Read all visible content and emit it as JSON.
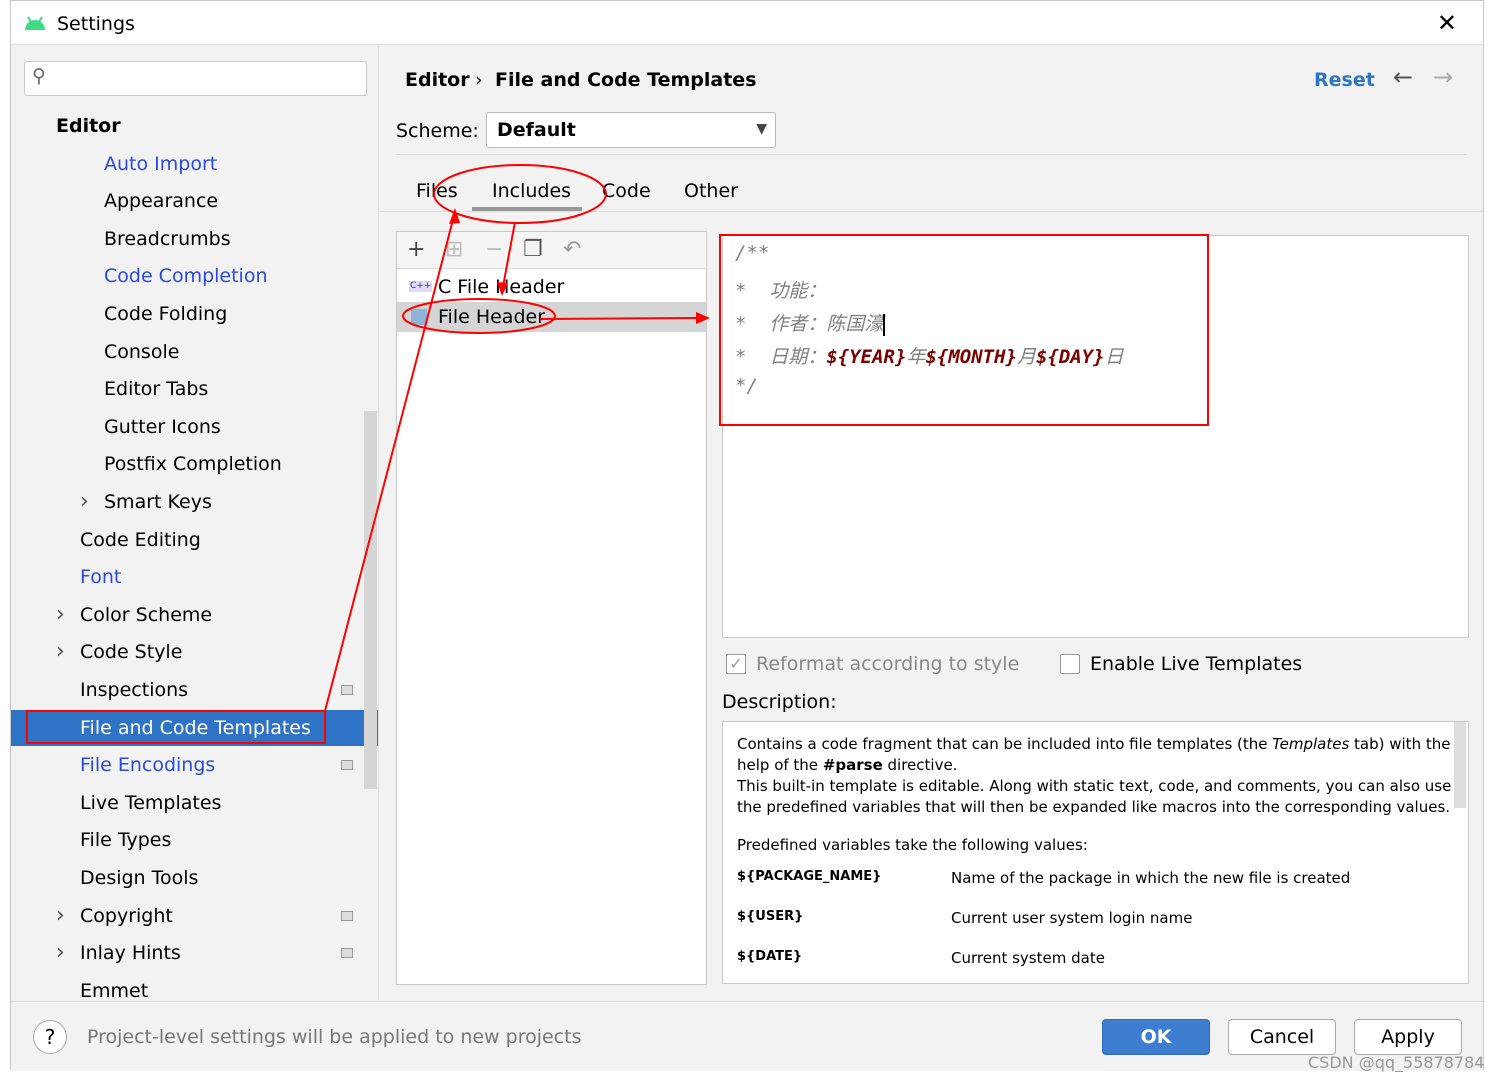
{
  "window": {
    "title": "Settings"
  },
  "sidebar": {
    "items": [
      {
        "label": "Editor",
        "level": 0,
        "bold": true
      },
      {
        "label": "Auto Import",
        "level": 2,
        "link": true
      },
      {
        "label": "Appearance",
        "level": 2
      },
      {
        "label": "Breadcrumbs",
        "level": 2
      },
      {
        "label": "Code Completion",
        "level": 2,
        "link": true
      },
      {
        "label": "Code Folding",
        "level": 2
      },
      {
        "label": "Console",
        "level": 2
      },
      {
        "label": "Editor Tabs",
        "level": 2
      },
      {
        "label": "Gutter Icons",
        "level": 2
      },
      {
        "label": "Postfix Completion",
        "level": 2
      },
      {
        "label": "Smart Keys",
        "level": 2,
        "chevron": true
      },
      {
        "label": "Code Editing",
        "level": 1
      },
      {
        "label": "Font",
        "level": 1,
        "link": true
      },
      {
        "label": "Color Scheme",
        "level": 1,
        "chevron": true
      },
      {
        "label": "Code Style",
        "level": 1,
        "chevron": true
      },
      {
        "label": "Inspections",
        "level": 1,
        "project": true
      },
      {
        "label": "File and Code Templates",
        "level": 1,
        "selected": true
      },
      {
        "label": "File Encodings",
        "level": 1,
        "link": true,
        "project": true
      },
      {
        "label": "Live Templates",
        "level": 1
      },
      {
        "label": "File Types",
        "level": 1
      },
      {
        "label": "Design Tools",
        "level": 1
      },
      {
        "label": "Copyright",
        "level": 1,
        "chevron": true,
        "project": true
      },
      {
        "label": "Inlay Hints",
        "level": 1,
        "chevron": true,
        "project": true
      },
      {
        "label": "Emmet",
        "level": 1
      }
    ]
  },
  "header": {
    "crumb1": "Editor",
    "sep": "›",
    "crumb2": "File and Code Templates",
    "reset": "Reset"
  },
  "scheme": {
    "label": "Scheme:",
    "value": "Default"
  },
  "tabs": [
    "Files",
    "Includes",
    "Code",
    "Other"
  ],
  "active_tab": "Includes",
  "templates": [
    {
      "label": "C File Header",
      "badge": "C++"
    },
    {
      "label": "File Header",
      "selected": true
    }
  ],
  "code": {
    "line1": "/**",
    "star": "*",
    "l2": "功能：",
    "l3": "作者：陈国濠",
    "l4a": "日期：",
    "year": "${YEAR}",
    "nian": "年",
    "month": "${MONTH}",
    "yue": "月",
    "day": "${DAY}",
    "ri": "日",
    "end": "*/"
  },
  "options": {
    "reformat": "Reformat according to style",
    "reformat_checked": true,
    "live": "Enable Live Templates",
    "live_checked": false
  },
  "description": {
    "label": "Description:",
    "p1a": "Contains a code fragment that can be included into file templates (the ",
    "p1b": "Templates",
    "p1c": " tab) with the help of the ",
    "p1d": "#parse",
    "p1e": " directive.",
    "p2": "This built-in template is editable. Along with static text, code, and comments, you can also use the predefined variables that will then be expanded like macros into the corresponding values.",
    "p3": "Predefined variables take the following values:",
    "vars": [
      {
        "name": "${PACKAGE_NAME}",
        "desc": "Name of the package in which the new file is created"
      },
      {
        "name": "${USER}",
        "desc": "Current user system login name"
      },
      {
        "name": "${DATE}",
        "desc": "Current system date"
      }
    ]
  },
  "footer": {
    "hint": "Project-level settings will be applied to new projects",
    "ok": "OK",
    "cancel": "Cancel",
    "apply": "Apply",
    "watermark": "CSDN @qq_55878784"
  },
  "colors": {
    "accent": "#2f73c7",
    "link": "#2a49e3",
    "annotation": "#ff0000",
    "variable": "#7d0000"
  }
}
